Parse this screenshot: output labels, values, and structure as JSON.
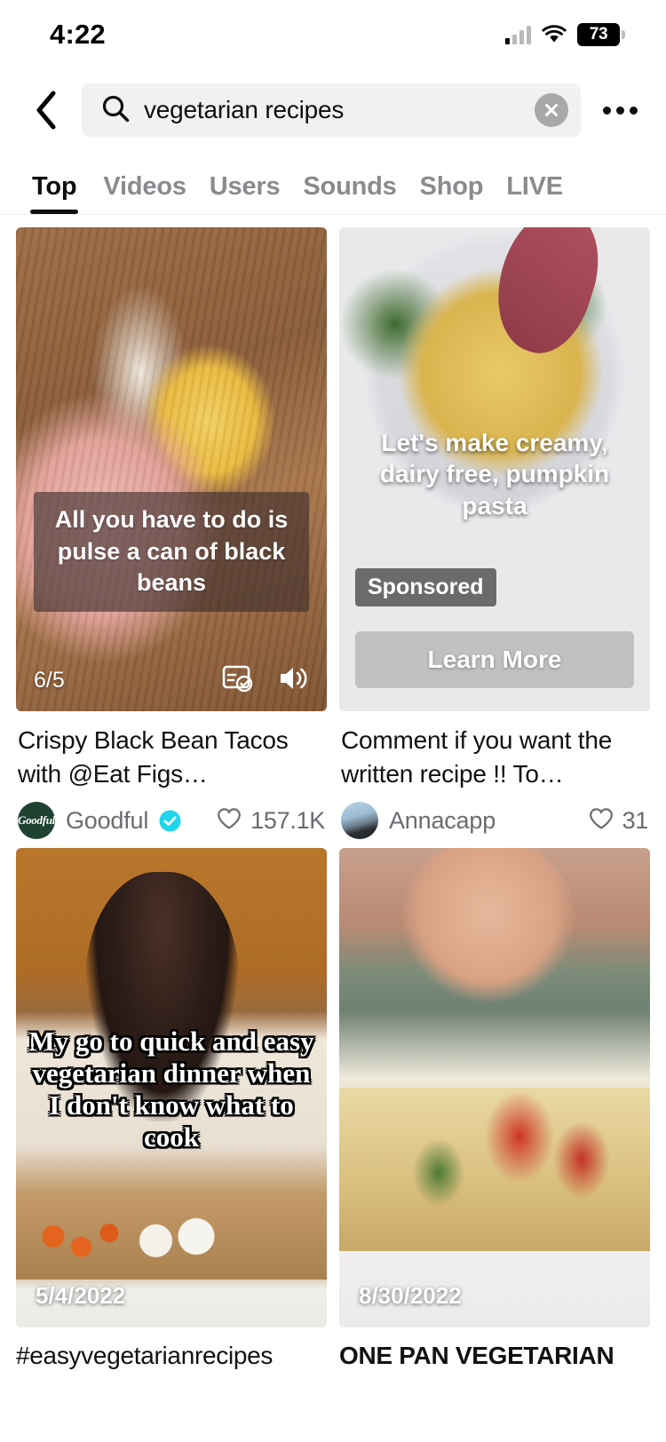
{
  "status_bar": {
    "time": "4:22",
    "battery_level": "73",
    "signal_icon": "cellular-signal-icon",
    "wifi_icon": "wifi-icon",
    "battery_icon": "battery-icon"
  },
  "header": {
    "back_icon": "back-chevron-icon",
    "search_icon": "search-icon",
    "search_value": "vegetarian recipes",
    "search_placeholder": "Search",
    "clear_icon": "clear-x-icon",
    "more_icon": "more-options-icon"
  },
  "tabs": [
    {
      "label": "Top",
      "active": true
    },
    {
      "label": "Videos",
      "active": false
    },
    {
      "label": "Users",
      "active": false
    },
    {
      "label": "Sounds",
      "active": false
    },
    {
      "label": "Shop",
      "active": false
    },
    {
      "label": "LIVE",
      "active": false
    }
  ],
  "results": [
    {
      "overlay_text": "All you have to do is pulse a can of black beans",
      "pages_indicator": "6/5",
      "caption_icon": "captions-check-icon",
      "volume_icon": "volume-on-icon",
      "title": "Crispy Black Bean Tacos with @Eat Figs…",
      "author": "Goodful",
      "avatar_text": "Goodful",
      "verified": true,
      "verified_icon": "verified-badge-icon",
      "like_icon": "heart-icon",
      "likes": "157.1K"
    },
    {
      "overlay_text": "Let's make creamy, dairy free, pumpkin pasta",
      "sponsored_label": "Sponsored",
      "cta_label": "Learn More",
      "title": "Comment if you want the written recipe !! To…",
      "author": "Annacapp",
      "verified": false,
      "like_icon": "heart-icon",
      "likes": "31"
    },
    {
      "overlay_text": "My go to quick and easy vegetarian dinner when I don't know what to cook",
      "date": "5/4/2022",
      "title": "#easyvegetarianrecipes"
    },
    {
      "overlay_text": "",
      "date": "8/30/2022",
      "title": "ONE PAN VEGETARIAN"
    }
  ],
  "colors": {
    "accent_verified": "#20d5ec",
    "text_primary": "#111111",
    "text_secondary": "#6b6b70",
    "search_bg": "#f1f1f2"
  }
}
